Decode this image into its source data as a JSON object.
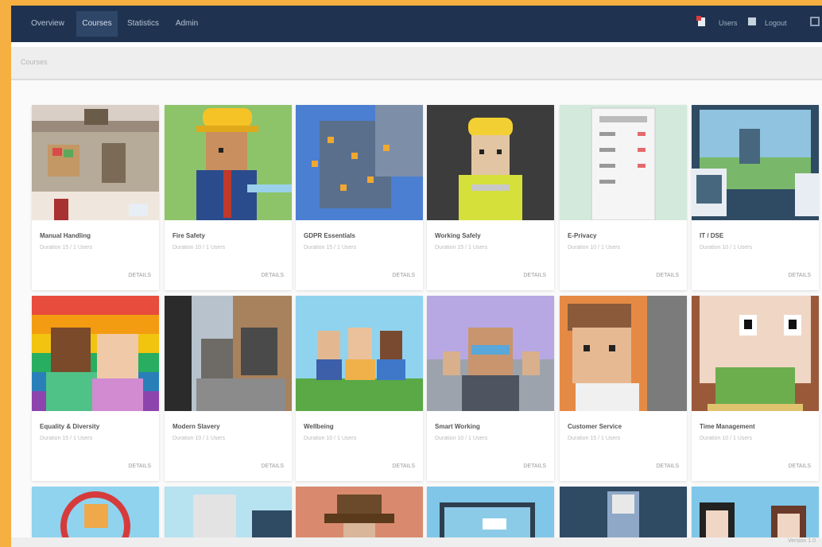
{
  "navbar": {
    "items": [
      "Overview",
      "Courses",
      "Statistics",
      "Admin"
    ],
    "active_index": 1,
    "user_label": "Users",
    "logout_label": "Logout"
  },
  "breadcrumb": "Courses",
  "courses": [
    {
      "title": "Manual Handling",
      "subtitle": "Duration 15 / 1 Users",
      "action": "DETAILS"
    },
    {
      "title": "Fire Safety",
      "subtitle": "Duration 10 / 1 Users",
      "action": "DETAILS"
    },
    {
      "title": "GDPR Essentials",
      "subtitle": "Duration 15 / 1 Users",
      "action": "DETAILS"
    },
    {
      "title": "Working Safely",
      "subtitle": "Duration 15 / 1 Users",
      "action": "DETAILS"
    },
    {
      "title": "E-Privacy",
      "subtitle": "Duration 10 / 1 Users",
      "action": "DETAILS"
    },
    {
      "title": "IT / DSE",
      "subtitle": "Duration 10 / 1 Users",
      "action": "DETAILS"
    },
    {
      "title": "Equality & Diversity",
      "subtitle": "Duration 15 / 1 Users",
      "action": "DETAILS"
    },
    {
      "title": "Modern Slavery",
      "subtitle": "Duration 10 / 1 Users",
      "action": "DETAILS"
    },
    {
      "title": "Wellbeing",
      "subtitle": "Duration 10 / 1 Users",
      "action": "DETAILS"
    },
    {
      "title": "Smart Working",
      "subtitle": "Duration 10 / 1 Users",
      "action": "DETAILS"
    },
    {
      "title": "Customer Service",
      "subtitle": "Duration 15 / 1 Users",
      "action": "DETAILS"
    },
    {
      "title": "Time Management",
      "subtitle": "Duration 10 / 1 Users",
      "action": "DETAILS"
    },
    {
      "title": "",
      "subtitle": "",
      "action": ""
    },
    {
      "title": "",
      "subtitle": "",
      "action": ""
    },
    {
      "title": "",
      "subtitle": "",
      "action": ""
    },
    {
      "title": "",
      "subtitle": "",
      "action": ""
    },
    {
      "title": "",
      "subtitle": "",
      "action": ""
    },
    {
      "title": "",
      "subtitle": "",
      "action": ""
    }
  ],
  "footer": "Version 1.0",
  "colors": {
    "frame": "#f5b041",
    "navbar": "#1f3350",
    "nav_active": "#2e4668"
  }
}
